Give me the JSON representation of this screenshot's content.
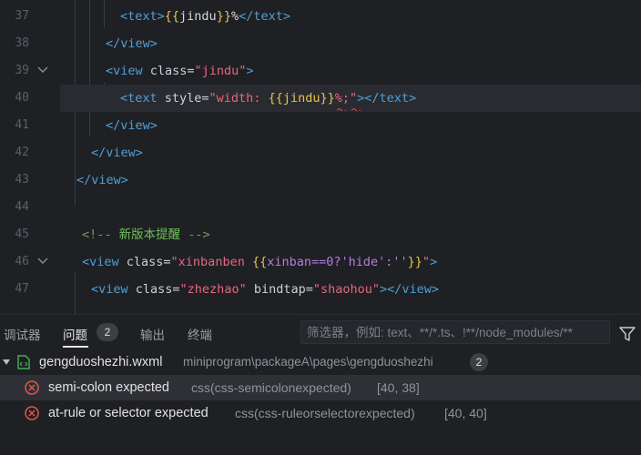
{
  "editor": {
    "line_numbers": [
      "37",
      "38",
      "39",
      "40",
      "41",
      "42",
      "43",
      "44",
      "45",
      "46",
      "47"
    ],
    "lines": {
      "l37": {
        "open": "<text>",
        "b1": "{{",
        "var": "jindu",
        "b2": "}}",
        "tail": "%",
        "close": "</text>"
      },
      "l38": {
        "close": "</view>"
      },
      "l39": {
        "open": "<view",
        "attr": " class=",
        "str": "\"jindu\"",
        "end": ">"
      },
      "l40": {
        "open": "<text",
        "attr": " style=",
        "str1": "\"width: ",
        "b1": "{{",
        "var": "jindu",
        "b2": "}}",
        "str2": "%;\"",
        "end": ">",
        "close": "</text>"
      },
      "l41": {
        "close": "</view>"
      },
      "l42": {
        "close": "</view>"
      },
      "l43": {
        "close": "</view>"
      },
      "l45": {
        "comment_open": "<!-- ",
        "comment_text": "新版本提醒",
        "comment_close": " -->"
      },
      "l46": {
        "open": "<view",
        "attr": " class=",
        "str1": "\"xinbanben ",
        "b1": "{{",
        "expr": "xinban==0?'hide':''",
        "b2": "}}",
        "str2": "\"",
        "end": ">"
      },
      "l47": {
        "open": "<view",
        "attr1": " class=",
        "str1": "\"zhezhao\"",
        "attr2": " bindtap=",
        "str2": "\"shaohou\"",
        "end": ">",
        "close": "</view>"
      }
    }
  },
  "panel": {
    "tabs": [
      "调试器",
      "问题",
      "输出",
      "终端"
    ],
    "problems_count": "2",
    "filter_placeholder": "筛选器，例如: text、**/*.ts、!**/node_modules/**",
    "file": {
      "name": "gengduoshezhi.wxml",
      "path": "miniprogram\\packageA\\pages\\gengduoshezhi",
      "count": "2"
    },
    "errors": [
      {
        "message": "semi-colon expected",
        "source": "css(css-semicolonexpected)",
        "position": "[40, 38]"
      },
      {
        "message": "at-rule or selector expected",
        "source": "css(css-ruleorselectorexpected)",
        "position": "[40, 40]"
      }
    ]
  },
  "colors": {
    "background": "#1f2024",
    "tag": "#4f9fd6",
    "string": "#e5677f",
    "brace": "#e6c44f",
    "error": "#e5544b",
    "file_icon": "#3fae4f"
  }
}
